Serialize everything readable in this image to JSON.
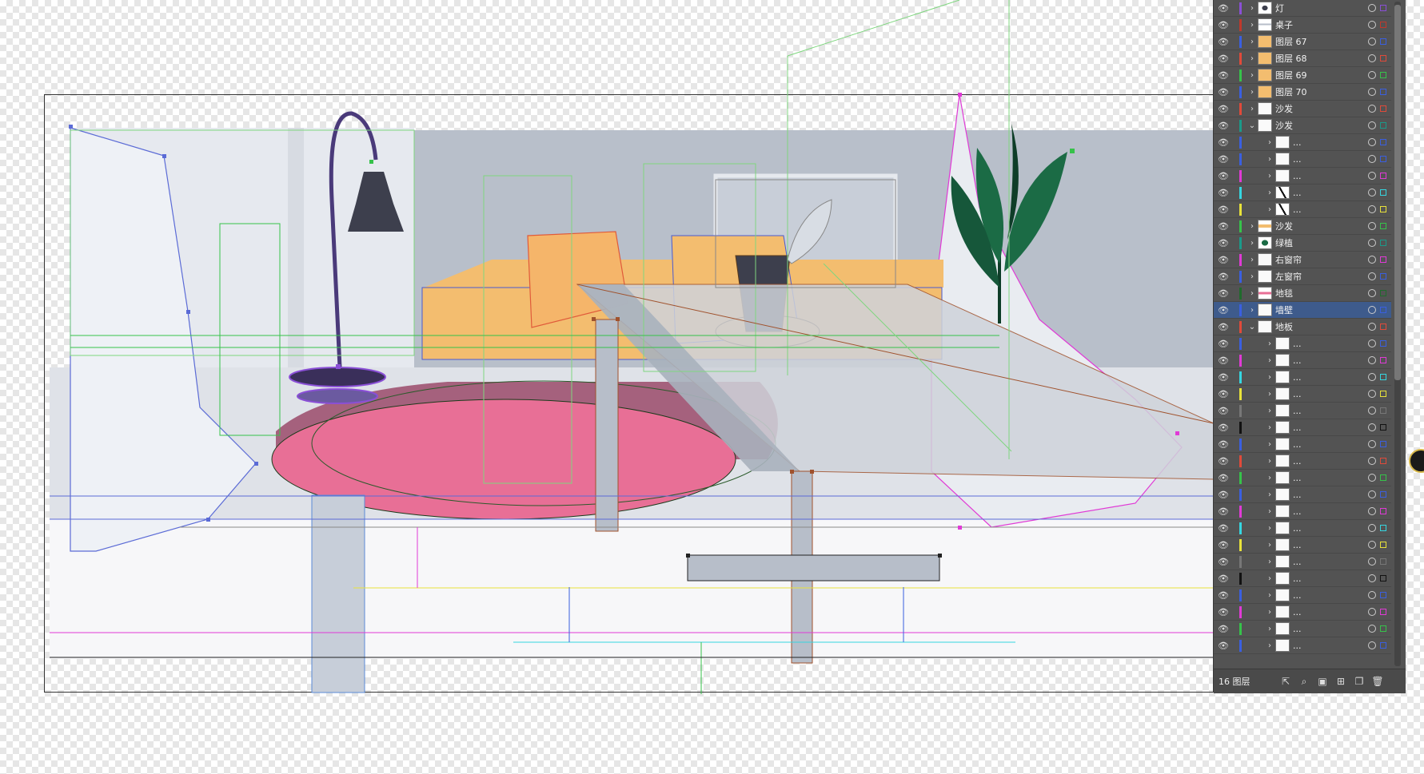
{
  "layers": [
    {
      "name": "灯",
      "color": "#8a4fd6",
      "thumb": "lamp",
      "expanded": false
    },
    {
      "name": "桌子",
      "color": "#c0392b",
      "thumb": "table",
      "expanded": false
    },
    {
      "name": "图层 67",
      "color": "#3a5fe0",
      "thumb": "orange",
      "expanded": false
    },
    {
      "name": "图层 68",
      "color": "#e04a3a",
      "thumb": "orange",
      "expanded": false
    },
    {
      "name": "图层 69",
      "color": "#36c24a",
      "thumb": "orange",
      "expanded": false
    },
    {
      "name": "图层 70",
      "color": "#3a5fe0",
      "thumb": "orange",
      "expanded": false
    },
    {
      "name": "沙发",
      "color": "#e04a3a",
      "thumb": "white",
      "expanded": false
    },
    {
      "name": "沙发",
      "color": "#1a9a8a",
      "thumb": "white",
      "expanded": true
    },
    {
      "name": "...",
      "color": "#3a5fe0",
      "thumb": "white",
      "expanded": false,
      "child": true
    },
    {
      "name": "...",
      "color": "#3a5fe0",
      "thumb": "white",
      "expanded": false,
      "child": true
    },
    {
      "name": "...",
      "color": "#e03ad6",
      "thumb": "white",
      "expanded": false,
      "child": true
    },
    {
      "name": "...",
      "color": "#35d6e0",
      "thumb": "stroke",
      "expanded": false,
      "child": true
    },
    {
      "name": "...",
      "color": "#e8e23a",
      "thumb": "stroke",
      "expanded": false,
      "child": true
    },
    {
      "name": "沙发",
      "color": "#36c24a",
      "thumb": "sofa",
      "expanded": false
    },
    {
      "name": "绿植",
      "color": "#1a9a8a",
      "thumb": "plant",
      "expanded": false
    },
    {
      "name": "右窗帘",
      "color": "#e03ad6",
      "thumb": "white",
      "expanded": false
    },
    {
      "name": "左窗帘",
      "color": "#3a5fe0",
      "thumb": "white",
      "expanded": false
    },
    {
      "name": "地毯",
      "color": "#1f6b2c",
      "thumb": "rug",
      "expanded": false
    },
    {
      "name": "墙壁",
      "color": "#3a5fe0",
      "thumb": "white",
      "expanded": false,
      "selected": true
    },
    {
      "name": "地板",
      "color": "#e04a3a",
      "thumb": "white",
      "expanded": true
    },
    {
      "name": "...",
      "color": "#3a5fe0",
      "thumb": "white",
      "expanded": false,
      "child": true
    },
    {
      "name": "...",
      "color": "#e03ad6",
      "thumb": "white",
      "expanded": false,
      "child": true
    },
    {
      "name": "...",
      "color": "#35d6e0",
      "thumb": "white",
      "expanded": false,
      "child": true
    },
    {
      "name": "...",
      "color": "#e8e23a",
      "thumb": "white",
      "expanded": false,
      "child": true
    },
    {
      "name": "...",
      "color": "#777777",
      "thumb": "white",
      "expanded": false,
      "child": true
    },
    {
      "name": "...",
      "color": "#111111",
      "thumb": "white",
      "expanded": false,
      "child": true
    },
    {
      "name": "...",
      "color": "#3a5fe0",
      "thumb": "white",
      "expanded": false,
      "child": true
    },
    {
      "name": "...",
      "color": "#e04a3a",
      "thumb": "white",
      "expanded": false,
      "child": true
    },
    {
      "name": "...",
      "color": "#36c24a",
      "thumb": "white",
      "expanded": false,
      "child": true
    },
    {
      "name": "...",
      "color": "#3a5fe0",
      "thumb": "white",
      "expanded": false,
      "child": true
    },
    {
      "name": "...",
      "color": "#e03ad6",
      "thumb": "white",
      "expanded": false,
      "child": true
    },
    {
      "name": "...",
      "color": "#35d6e0",
      "thumb": "white",
      "expanded": false,
      "child": true
    },
    {
      "name": "...",
      "color": "#e8e23a",
      "thumb": "white",
      "expanded": false,
      "child": true
    },
    {
      "name": "...",
      "color": "#777777",
      "thumb": "white",
      "expanded": false,
      "child": true
    },
    {
      "name": "...",
      "color": "#111111",
      "thumb": "white",
      "expanded": false,
      "child": true
    },
    {
      "name": "...",
      "color": "#3a5fe0",
      "thumb": "white",
      "expanded": false,
      "child": true
    },
    {
      "name": "...",
      "color": "#e03ad6",
      "thumb": "white",
      "expanded": false,
      "child": true
    },
    {
      "name": "...",
      "color": "#36c24a",
      "thumb": "white",
      "expanded": false,
      "child": true
    },
    {
      "name": "...",
      "color": "#3a5fe0",
      "thumb": "white",
      "expanded": false,
      "child": true
    }
  ],
  "footer": {
    "layer_count": "16 图层",
    "icons": [
      "export-icon",
      "search-icon",
      "clipping-mask-icon",
      "sublayer-icon",
      "new-layer-icon",
      "trash-icon"
    ]
  },
  "colors": {
    "panel_bg": "#535353",
    "selected_row": "#3e5b8c",
    "wall": "#b8bfca",
    "sofa": "#f3bd6f",
    "rug": "#e86f96",
    "plant": "#1b6b45"
  }
}
